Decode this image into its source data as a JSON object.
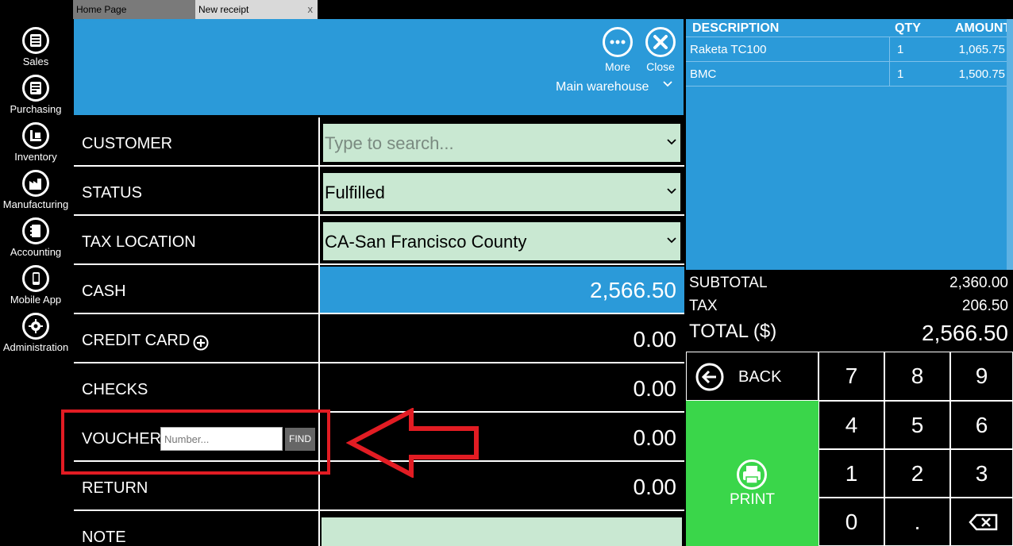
{
  "nav": [
    {
      "label": "Sales",
      "icon": "sales-icon"
    },
    {
      "label": "Purchasing",
      "icon": "purchasing-icon"
    },
    {
      "label": "Inventory",
      "icon": "inventory-icon"
    },
    {
      "label": "Manufacturing",
      "icon": "manufacturing-icon"
    },
    {
      "label": "Accounting",
      "icon": "accounting-icon"
    },
    {
      "label": "Mobile App",
      "icon": "mobile-app-icon"
    },
    {
      "label": "Administration",
      "icon": "gear-icon"
    }
  ],
  "tabs": {
    "home": "Home Page",
    "new_receipt": "New receipt",
    "close": "x"
  },
  "header": {
    "more_label": "More",
    "close_label": "Close",
    "warehouse": "Main warehouse"
  },
  "form": {
    "customer": {
      "label": "CUSTOMER",
      "placeholder": "Type to search..."
    },
    "status": {
      "label": "STATUS",
      "value": "Fulfilled"
    },
    "tax_location": {
      "label": "TAX LOCATION",
      "value": "CA-San Francisco County"
    },
    "cash": {
      "label": "CASH",
      "value": "2,566.50"
    },
    "credit_card": {
      "label": "CREDIT CARD",
      "value": "0.00"
    },
    "checks": {
      "label": "CHECKS",
      "value": "0.00"
    },
    "voucher": {
      "label": "VOUCHER",
      "placeholder": "Number...",
      "find": "FIND",
      "value": "0.00"
    },
    "return": {
      "label": "RETURN",
      "value": "0.00"
    },
    "note": {
      "label": "NOTE"
    }
  },
  "items": {
    "headers": {
      "description": "DESCRIPTION",
      "qty": "QTY",
      "amount": "AMOUNT"
    },
    "rows": [
      {
        "description": "Raketa TC100",
        "qty": "1",
        "amount": "1,065.75"
      },
      {
        "description": "BMC",
        "qty": "1",
        "amount": "1,500.75"
      }
    ]
  },
  "totals": {
    "subtotal_label": "SUBTOTAL",
    "subtotal": "2,360.00",
    "tax_label": "TAX",
    "tax": "206.50",
    "total_label": "TOTAL ($)",
    "total": "2,566.50"
  },
  "keypad": {
    "back": "BACK",
    "print": "PRINT",
    "keys": [
      "7",
      "8",
      "9",
      "4",
      "5",
      "6",
      "1",
      "2",
      "3",
      "0",
      "."
    ]
  },
  "colors": {
    "accent_blue": "#2b9ad9",
    "field_green": "#c9e8d2",
    "print_green": "#3ad64a",
    "highlight_red": "#e21c23"
  }
}
